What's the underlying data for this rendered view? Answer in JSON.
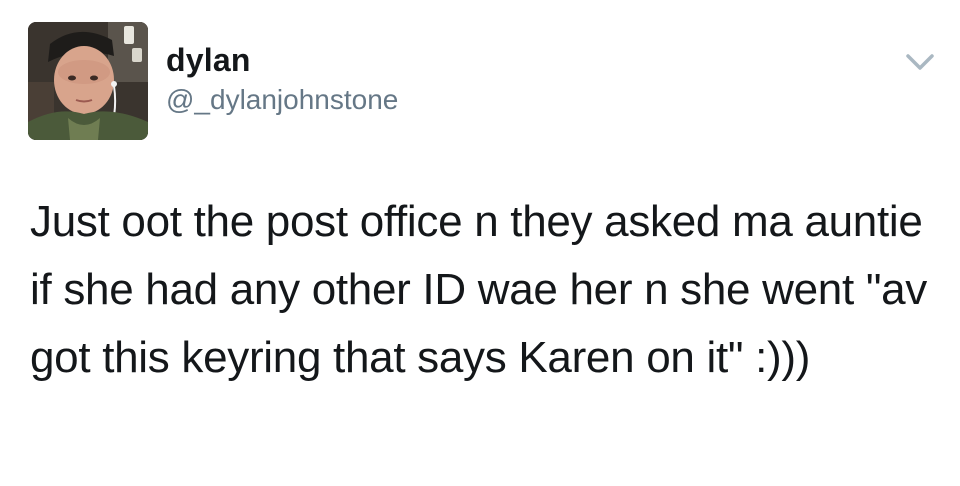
{
  "tweet": {
    "author": {
      "display_name": "dylan",
      "handle": "@_dylanjohnstone",
      "avatar_icon": "profile-photo"
    },
    "menu_icon": "chevron-down-icon",
    "text": "Just oot the post office n they asked ma auntie if she had any other ID wae her n she went \"av got this keyring that says Karen on it\" :)))",
    "colors": {
      "text": "#14171a",
      "secondary": "#657786",
      "caret": "#aab8c2",
      "background": "#ffffff"
    }
  }
}
